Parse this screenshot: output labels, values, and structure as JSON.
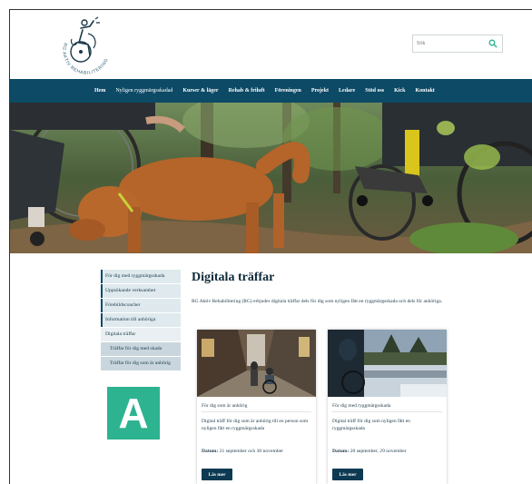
{
  "logo": {
    "text": "RG AKTIV REHABILITERING"
  },
  "search": {
    "placeholder": "Sök"
  },
  "nav": {
    "items": [
      "Hem",
      "Nyligen ryggmärgsskadad",
      "Kurser & läger",
      "Rehab & friluft",
      "Föreningen",
      "Projekt",
      "Ledare",
      "Stöd oss",
      "Kick",
      "Kontakt"
    ]
  },
  "sidebar": {
    "items": [
      "För dig med ryggmärgsskada",
      "Uppsökande verksamhet",
      "Förebildscoacher",
      "Information till anhöriga",
      "Digitala träffar",
      "Träffar för dig med skada",
      "Träffar för dig som är anhörig"
    ]
  },
  "badge": {
    "letter": "A"
  },
  "main": {
    "title": "Digitala träffar",
    "intro": "RG Aktiv Rehabilitering (RG) erbjuder digitala träffar dels för dig som nyligen fått en ryggmärgsskada och dels för anhöriga."
  },
  "cards": [
    {
      "category": "För dig som är anhörig",
      "text": "Digital träff för dig som är anhörig till en person som nyligen fått en ryggmärgsskada",
      "date_label": "Datum:",
      "date_value": " 21 september och 30 november",
      "button": "Läs mer"
    },
    {
      "category": "För dig med ryggmärgsskada",
      "text": "Digital träff för dig som nyligen fått en ryggmärgsskada",
      "date_label": "Datum:",
      "date_value": " 20 september, 29 november",
      "button": "Läs mer"
    }
  ],
  "colors": {
    "nav_bg": "#0d4a66",
    "sidebar_bg": "#dfe9ee",
    "badge": "#2db38f",
    "button": "#0d3a52",
    "search_icon": "#2db38f"
  }
}
